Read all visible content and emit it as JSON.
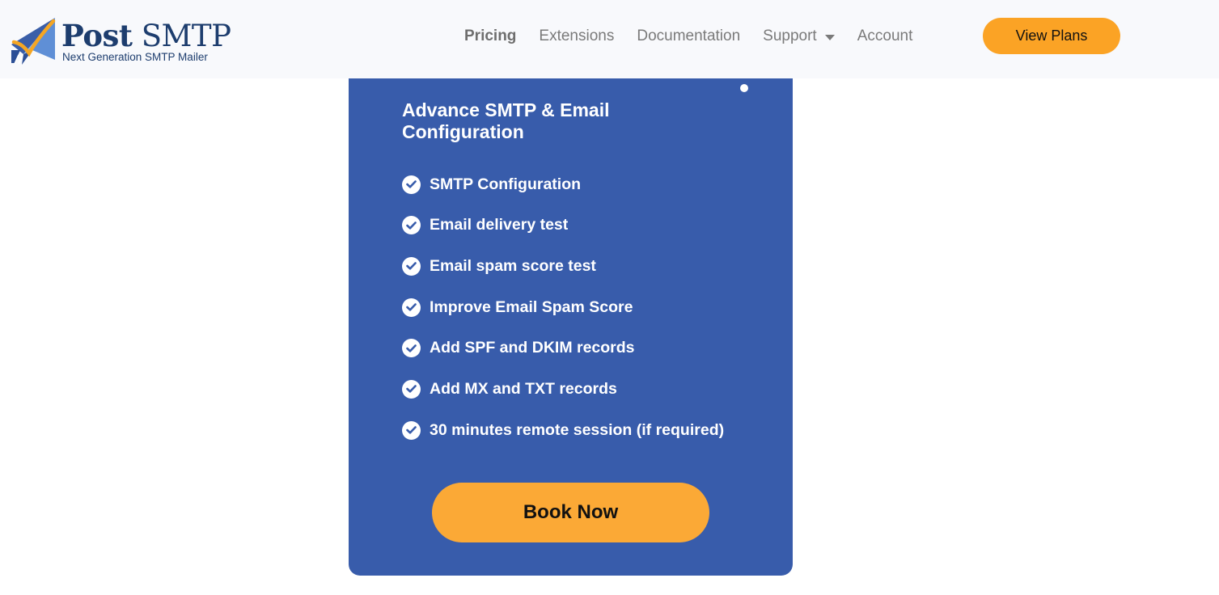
{
  "header": {
    "logo": {
      "title_bold": "Post",
      "title_light": " SMTP",
      "subtitle": "Next Generation SMTP Mailer"
    },
    "nav": [
      {
        "label": "Pricing",
        "active": true
      },
      {
        "label": "Extensions"
      },
      {
        "label": "Documentation"
      },
      {
        "label": "Support",
        "has_dropdown": true
      },
      {
        "label": "Account"
      }
    ],
    "cta_label": "View Plans"
  },
  "card": {
    "title": "Advance SMTP & Email Configuration",
    "features": [
      "SMTP Configuration",
      "Email delivery test",
      "Email spam score test",
      "Improve Email Spam Score",
      "Add SPF and DKIM records",
      "Add MX and TXT records",
      "30 minutes remote session (if required)"
    ],
    "button_label": "Book Now"
  },
  "colors": {
    "header_bg": "#f8f9fc",
    "card_bg": "#385cab",
    "accent_orange": "#fba325",
    "brand_navy": "#1d3d6e",
    "nav_text": "#7a7a7a"
  },
  "icons": {
    "feature_bullet": "check-circle-icon",
    "support_caret": "caret-down-icon",
    "logo_mark": "paper-plane-icon"
  }
}
